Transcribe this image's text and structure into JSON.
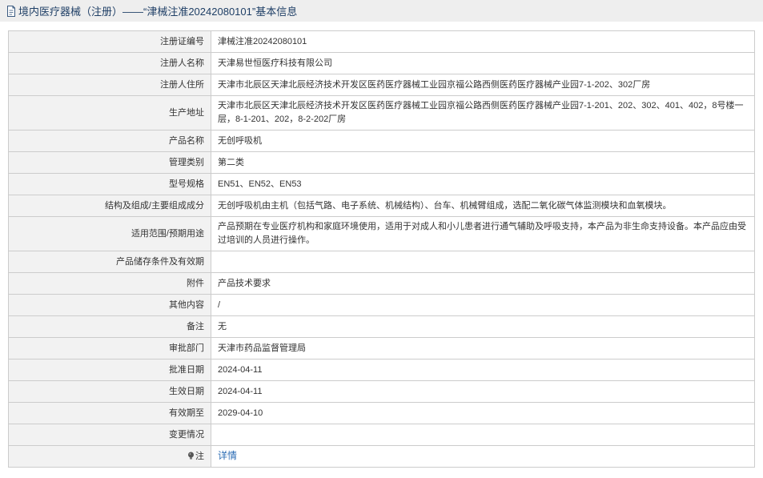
{
  "header": {
    "title": "境内医疗器械（注册）——“津械注准20242080101”基本信息",
    "icon": "document-icon"
  },
  "rows": [
    {
      "label": "注册证编号",
      "value": "津械注准20242080101"
    },
    {
      "label": "注册人名称",
      "value": "天津易世恒医疗科技有限公司"
    },
    {
      "label": "注册人住所",
      "value": "天津市北辰区天津北辰经济技术开发区医药医疗器械工业园京福公路西侧医药医疗器械产业园7-1-202、302厂房"
    },
    {
      "label": "生产地址",
      "value": "天津市北辰区天津北辰经济技术开发区医药医疗器械工业园京福公路西侧医药医疗器械产业园7-1-201、202、302、401、402，8号楼一层，8-1-201、202，8-2-202厂房"
    },
    {
      "label": "产品名称",
      "value": "无创呼吸机"
    },
    {
      "label": "管理类别",
      "value": "第二类"
    },
    {
      "label": "型号规格",
      "value": "EN51、EN52、EN53"
    },
    {
      "label": "结构及组成/主要组成成分",
      "value": "无创呼吸机由主机（包括气路、电子系统、机械结构）、台车、机械臂组成，选配二氧化碳气体监测模块和血氧模块。"
    },
    {
      "label": "适用范围/预期用途",
      "value": "产品预期在专业医疗机构和家庭环境使用，适用于对成人和小儿患者进行通气辅助及呼吸支持，本产品为非生命支持设备。本产品应由受过培训的人员进行操作。"
    },
    {
      "label": "产品储存条件及有效期",
      "value": ""
    },
    {
      "label": "附件",
      "value": "产品技术要求"
    },
    {
      "label": "其他内容",
      "value": "/"
    },
    {
      "label": "备注",
      "value": "无"
    },
    {
      "label": "审批部门",
      "value": "天津市药品监督管理局"
    },
    {
      "label": "批准日期",
      "value": "2024-04-11"
    },
    {
      "label": "生效日期",
      "value": "2024-04-11"
    },
    {
      "label": "有效期至",
      "value": "2029-04-10"
    },
    {
      "label": "变更情况",
      "value": ""
    }
  ],
  "note": {
    "label": "注",
    "icon": "lightbulb-icon",
    "link_text": "详情"
  },
  "colors": {
    "header_bg": "#eeeeee",
    "header_text": "#1f3f66",
    "label_bg": "#f2f2f2",
    "border": "#cccccc",
    "link": "#2b6cb4"
  }
}
